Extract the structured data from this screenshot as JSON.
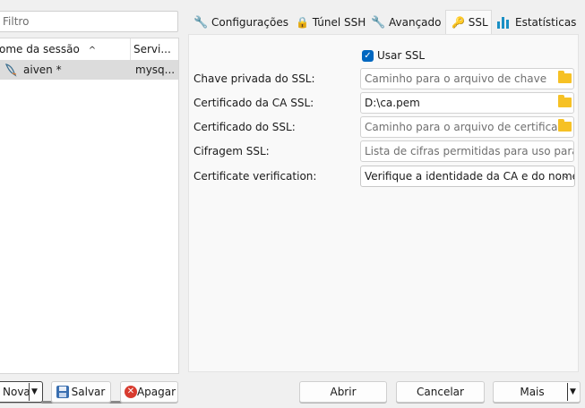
{
  "left": {
    "filter_placeholder": "Filtro",
    "columns": [
      "ome da sessão",
      "Servi..."
    ],
    "sort_indicator": "^",
    "sessions": [
      {
        "name": "aiven *",
        "server": "mysq..."
      }
    ]
  },
  "bottom_left": {
    "new_label": "Nova",
    "save_label": "Salvar",
    "delete_label": "Apagar"
  },
  "tabs": [
    {
      "label": "Configurações",
      "icon": "wrench-icon"
    },
    {
      "label": "Túnel SSH",
      "icon": "lock-icon"
    },
    {
      "label": "Avançado",
      "icon": "wrench-icon"
    },
    {
      "label": "SSL",
      "icon": "key-icon"
    },
    {
      "label": "Estatísticas",
      "icon": "bar-chart-icon"
    }
  ],
  "active_tab": "SSL",
  "ssl": {
    "use_ssl_label": "Usar SSL",
    "use_ssl_checked": true,
    "private_key_label": "Chave privada do SSL:",
    "private_key_placeholder": "Caminho para o arquivo de chave",
    "ca_cert_label": "Certificado da CA SSL:",
    "ca_cert_value": "D:\\ca.pem",
    "cert_label": "Certificado do SSL:",
    "cert_placeholder": "Caminho para o arquivo de certificado",
    "cipher_label": "Cifragem SSL:",
    "cipher_placeholder": "Lista de cifras permitidas para uso para cripto",
    "verification_label": "Certificate verification:",
    "verification_value": "Verifique a identidade da CA e do nome d"
  },
  "bottom_right": {
    "open_label": "Abrir",
    "cancel_label": "Cancelar",
    "more_label": "Mais"
  },
  "colors": {
    "accent": "#0067c0",
    "folder": "#f6c125",
    "selection": "#dcdcdc"
  }
}
